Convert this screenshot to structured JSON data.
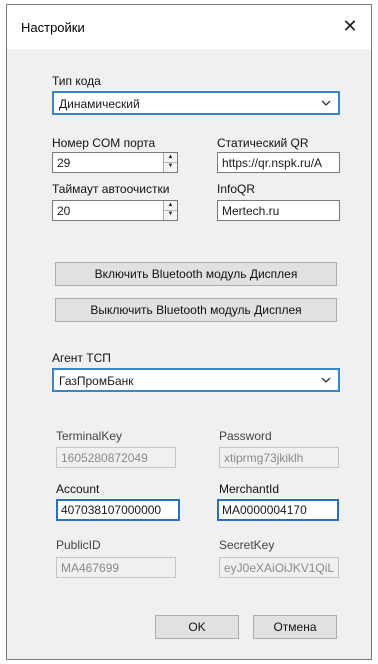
{
  "window": {
    "title": "Настройки",
    "close_label": "✕"
  },
  "code_type": {
    "label": "Тип кода",
    "value": "Динамический"
  },
  "com_port": {
    "label": "Номер COM порта",
    "value": "29"
  },
  "static_qr": {
    "label": "Статический QR",
    "value": "https://qr.nspk.ru/A"
  },
  "autoclear_timeout": {
    "label": "Таймаут автоочистки",
    "value": "20"
  },
  "info_qr": {
    "label": "InfoQR",
    "value": "Mertech.ru"
  },
  "buttons": {
    "bt_enable": "Включить Bluetooth модуль Дисплея",
    "bt_disable": "Выключить Bluetooth модуль Дисплея",
    "ok": "OK",
    "cancel": "Отмена"
  },
  "tsp_agent": {
    "label": "Агент ТСП",
    "value": "ГазПромБанк"
  },
  "terminal_key": {
    "label": "TerminalKey",
    "value": "1605280872049"
  },
  "password": {
    "label": "Password",
    "value": "xtiprmg73jkiklh"
  },
  "account": {
    "label": "Account",
    "value": "407038107000000"
  },
  "merchant_id": {
    "label": "MerchantId",
    "value": "MA0000004170"
  },
  "public_id": {
    "label": "PublicID",
    "value": "MA467699"
  },
  "secret_key": {
    "label": "SecretKey",
    "value": "eyJ0eXAiOiJKV1QiL"
  },
  "colors": {
    "focus_blue": "#3c84c8",
    "window_bg": "#f0f0f0",
    "button_bg": "#e1e1e1"
  }
}
